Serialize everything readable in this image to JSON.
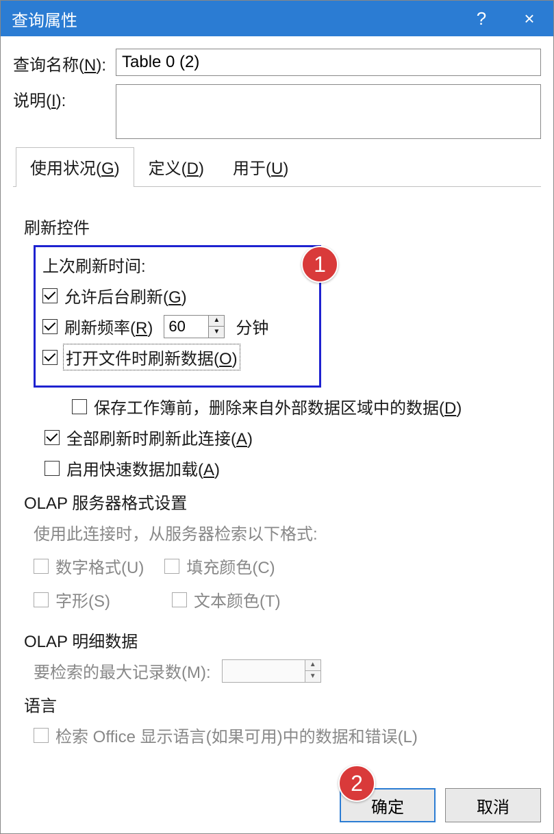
{
  "titlebar": {
    "title": "查询属性",
    "help": "?",
    "close": "×"
  },
  "fields": {
    "name_label": "查询名称(N):",
    "name_value": "Table 0 (2)",
    "desc_label": "说明(I):",
    "desc_value": ""
  },
  "tabs": {
    "usage": "使用状况(G)",
    "definition": "定义(D)",
    "usedin": "用于(U)"
  },
  "refresh": {
    "section": "刷新控件",
    "last_refresh": "上次刷新时间:",
    "allow_bg": "允许后台刷新(G)",
    "freq_label": "刷新频率(R)",
    "freq_value": "60",
    "freq_unit": "分钟",
    "on_open": "打开文件时刷新数据(O)",
    "remove_on_save": "保存工作簿前，删除来自外部数据区域中的数据(D)",
    "refresh_all": "全部刷新时刷新此连接(A)",
    "fast_load": "启用快速数据加载(A)"
  },
  "olap_format": {
    "section": "OLAP 服务器格式设置",
    "hint": "使用此连接时，从服务器检索以下格式:",
    "number_format": "数字格式(U)",
    "fill_color": "填充颜色(C)",
    "font_style": "字形(S)",
    "text_color": "文本颜色(T)"
  },
  "olap_detail": {
    "section": "OLAP 明细数据",
    "max_records": "要检索的最大记录数(M):",
    "max_value": ""
  },
  "lang": {
    "section": "语言",
    "retrieve": "检索 Office 显示语言(如果可用)中的数据和错误(L)"
  },
  "buttons": {
    "ok": "确定",
    "cancel": "取消"
  },
  "badges": {
    "one": "1",
    "two": "2"
  }
}
